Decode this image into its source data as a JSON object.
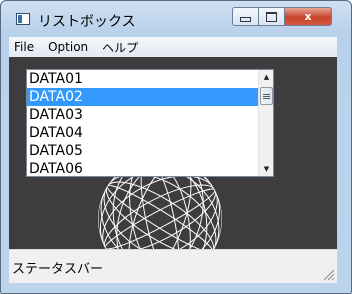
{
  "window": {
    "title": "リストボックス",
    "icon": "window-app-icon"
  },
  "caption_buttons": {
    "minimize": "minimize-icon",
    "maximize": "maximize-icon",
    "close": "x",
    "close_color": "#c7432b"
  },
  "menu": {
    "items": [
      {
        "label": "File"
      },
      {
        "label": "Option"
      },
      {
        "label": "ヘルプ"
      }
    ]
  },
  "listbox": {
    "items": [
      "DATA01",
      "DATA02",
      "DATA03",
      "DATA04",
      "DATA05",
      "DATA06"
    ],
    "selected_index": 1,
    "selected_color": "#3399ff"
  },
  "statusbar": {
    "text": "ステータスバー"
  }
}
